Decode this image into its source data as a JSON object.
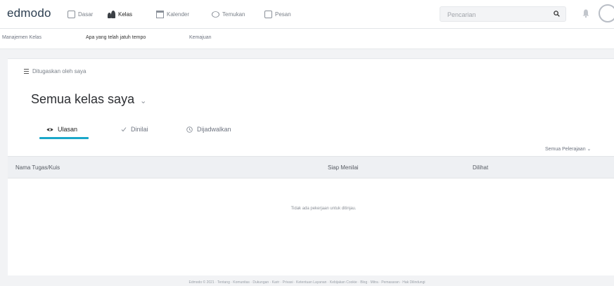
{
  "app": {
    "logo": "edmodo"
  },
  "nav": {
    "items": [
      {
        "label": "Dasar",
        "icon": "home-icon"
      },
      {
        "label": "Kelas",
        "icon": "classes-icon"
      },
      {
        "label": "Kalender",
        "icon": "calendar-icon"
      },
      {
        "label": "Temukan",
        "icon": "discover-icon"
      },
      {
        "label": "Pesan",
        "icon": "messages-icon"
      }
    ],
    "active": "Kelas"
  },
  "search": {
    "placeholder": "Pencarian"
  },
  "subnav": {
    "items": [
      "Manajemen Kelas",
      "Apa yang telah jatuh tempo",
      "Kemajuan"
    ],
    "active": "Apa yang telah jatuh tempo"
  },
  "main": {
    "owner_filter": "Ditugaskan oleh saya",
    "title": "Semua kelas saya",
    "tabs": [
      {
        "label": "Ulasan",
        "icon": "eye-icon"
      },
      {
        "label": "Dinilai",
        "icon": "check-icon"
      },
      {
        "label": "Dijadwalkan",
        "icon": "clock-icon"
      }
    ],
    "active_tab": "Ulasan",
    "sort_label": "Semua Pelerajaan ⌄",
    "columns": [
      "Nama Tugas/Kuis",
      "Siap Menilai",
      "Dilihat"
    ],
    "empty_message": "Tidak ada pekerjaan untuk ditinjau."
  },
  "footer": {
    "text": "Edmodo © 2021 · Tentang · Komunitas · Dukungan · Karir · Privasi · Ketentuan Layanan · Kebijakan Cookie · Blog · Mitra · Pemasaran · Hak Dilindungi"
  },
  "colors": {
    "accent": "#1aa7c9",
    "background": "#f2f3f5"
  }
}
